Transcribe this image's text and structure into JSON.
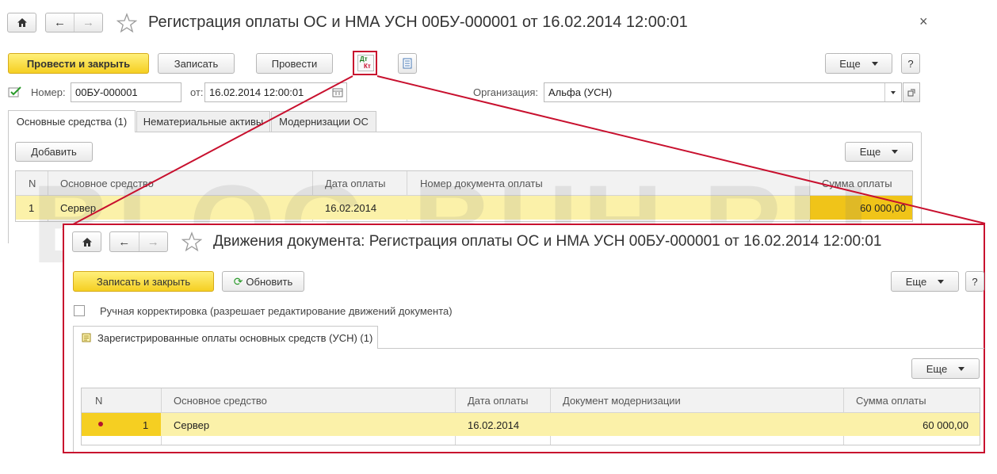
{
  "main": {
    "title": "Регистрация оплаты ОС и НМА УСН 00БУ-000001 от 16.02.2014 12:00:01",
    "close_symbol": "×",
    "toolbar": {
      "post_close": "Провести и закрыть",
      "save": "Записать",
      "post": "Провести",
      "dtkt_top": "Дт",
      "dtkt_bottom": "Кт",
      "more": "Еще",
      "help": "?"
    },
    "form": {
      "number_label": "Номер:",
      "number_value": "00БУ-000001",
      "date_label": "от:",
      "date_value": "16.02.2014 12:00:01",
      "org_label": "Организация:",
      "org_value": "Альфа (УСН)"
    },
    "tabs": [
      "Основные средства (1)",
      "Нематериальные активы",
      "Модернизации ОС"
    ],
    "add_button": "Добавить",
    "more": "Еще",
    "table": {
      "headers": [
        "N",
        "Основное средство",
        "Дата оплаты",
        "Номер документа оплаты",
        "Сумма оплаты"
      ],
      "rows": [
        {
          "n": "1",
          "asset": "Сервер",
          "date": "16.02.2014",
          "doc": "",
          "sum": "60 000,00"
        }
      ]
    }
  },
  "popup": {
    "title": "Движения документа: Регистрация оплаты ОС и НМА УСН 00БУ-000001 от 16.02.2014 12:00:01",
    "save_close": "Записать и закрыть",
    "refresh": "Обновить",
    "more": "Еще",
    "help": "?",
    "manual_label": "Ручная корректировка (разрешает редактирование движений документа)",
    "tab": "Зарегистрированные оплаты основных средств (УСН) (1)",
    "more2": "Еще",
    "table": {
      "headers": [
        "N",
        "Основное средство",
        "Дата оплаты",
        "Документ модернизации",
        "Сумма оплаты"
      ],
      "rows": [
        {
          "n": "1",
          "asset": "Сервер",
          "date": "16.02.2014",
          "doc": "",
          "sum": "60 000,00"
        }
      ]
    }
  },
  "watermark": "BLOG-BUH.RU",
  "colors": {
    "accent_yellow": "#f5cf22",
    "row_highlight": "#fbf1a9",
    "callout_red": "#c8102e"
  }
}
